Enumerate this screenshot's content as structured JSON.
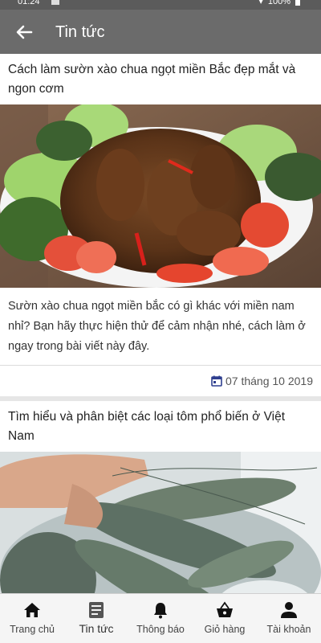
{
  "status": {
    "time": "01:24",
    "battery": "100%"
  },
  "header": {
    "title": "Tin tức"
  },
  "articles": [
    {
      "title": "Cách làm sườn xào chua ngọt miền Bắc đẹp mắt và ngon cơm",
      "description": "Sườn xào chua ngọt miền bắc có gì khác với miền nam nhỉ? Bạn hãy thực hiện thử để cảm nhận nhé, cách làm ở ngay trong bài viết này đây.",
      "date": "07 tháng 10 2019"
    },
    {
      "title": "Tìm hiểu và phân biệt các loại tôm phổ biến ở Việt Nam",
      "description": "",
      "date": ""
    }
  ],
  "nav": {
    "items": [
      {
        "label": "Trang chủ",
        "icon": "home-icon"
      },
      {
        "label": "Tin tức",
        "icon": "news-icon"
      },
      {
        "label": "Thông báo",
        "icon": "bell-icon"
      },
      {
        "label": "Giỏ hàng",
        "icon": "basket-icon"
      },
      {
        "label": "Tài khoản",
        "icon": "person-icon"
      }
    ],
    "active": "Tin tức"
  },
  "colors": {
    "app_bar": "#6b6b6b",
    "status_bar": "#5b5b5b",
    "date_icon": "#2f3f8f"
  }
}
